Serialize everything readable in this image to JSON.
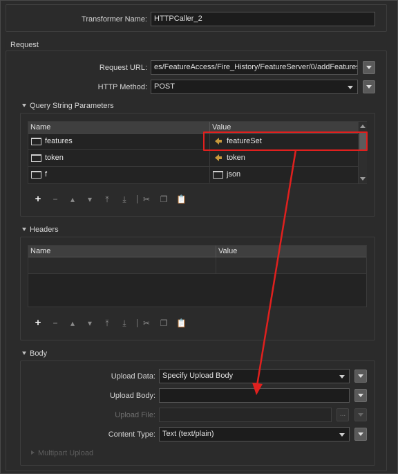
{
  "transformer_name": {
    "label": "Transformer Name:",
    "value": "HTTPCaller_2"
  },
  "request": {
    "section_label": "Request",
    "url_label": "Request URL:",
    "url_value": "es/FeatureAccess/Fire_History/FeatureServer/0/addFeatures",
    "method_label": "HTTP Method:",
    "method_value": "POST"
  },
  "query_params": {
    "section_label": "Query String Parameters",
    "columns": [
      "Name",
      "Value"
    ],
    "rows": [
      {
        "name": "features",
        "value": "featureSet",
        "value_icon": "feature-attribute-icon"
      },
      {
        "name": "token",
        "value": "token",
        "value_icon": "feature-attribute-icon"
      },
      {
        "name": "f",
        "value": "json",
        "value_icon": "attribute-icon"
      }
    ]
  },
  "headers": {
    "section_label": "Headers",
    "columns": [
      "Name",
      "Value"
    ]
  },
  "table_toolbar": {
    "icons": [
      "add-icon",
      "remove-icon",
      "move-up-icon",
      "move-down-icon",
      "move-top-icon",
      "move-bottom-icon",
      "cut-icon",
      "copy-icon",
      "paste-icon"
    ]
  },
  "body": {
    "section_label": "Body",
    "upload_data_label": "Upload Data:",
    "upload_data_value": "Specify Upload Body",
    "upload_body_label": "Upload Body:",
    "upload_body_value": "",
    "upload_file_label": "Upload File:",
    "upload_file_value": "",
    "browse_label": "...",
    "content_type_label": "Content Type:",
    "content_type_value": "Text (text/plain)",
    "multipart_label": "Multipart Upload"
  },
  "colors": {
    "highlight": "#e0201e",
    "feature_icon": "#c8993c"
  }
}
